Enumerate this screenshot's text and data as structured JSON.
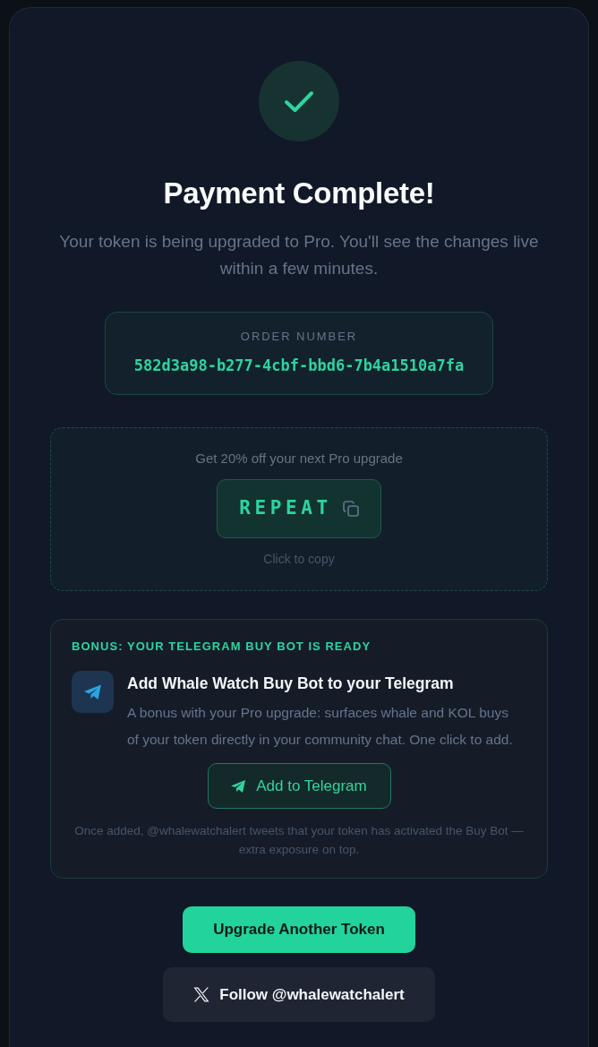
{
  "title": "Payment Complete!",
  "message": "Your token is being upgraded to Pro. You'll see the changes live within a few minutes.",
  "order": {
    "label": "ORDER NUMBER",
    "number": "582d3a98-b277-4cbf-bbd6-7b4a1510a7fa"
  },
  "promo": {
    "caption": "Get 20% off your next Pro upgrade",
    "code": "REPEAT",
    "hint": "Click to copy"
  },
  "bonus": {
    "heading": "BONUS: YOUR TELEGRAM BUY BOT IS READY",
    "title": "Add Whale Watch Buy Bot to your Telegram",
    "description": "A bonus with your Pro upgrade: surfaces whale and KOL buys of your token directly in your community chat. One click to add.",
    "button": "Add to Telegram",
    "note": "Once added, @whalewatchalert tweets that your token has activated the Buy Bot — extra exposure on top."
  },
  "actions": [
    {
      "kind": "primary",
      "label": "Upgrade Another Token"
    },
    {
      "kind": "social",
      "label": "Follow @whalewatchalert"
    }
  ]
}
